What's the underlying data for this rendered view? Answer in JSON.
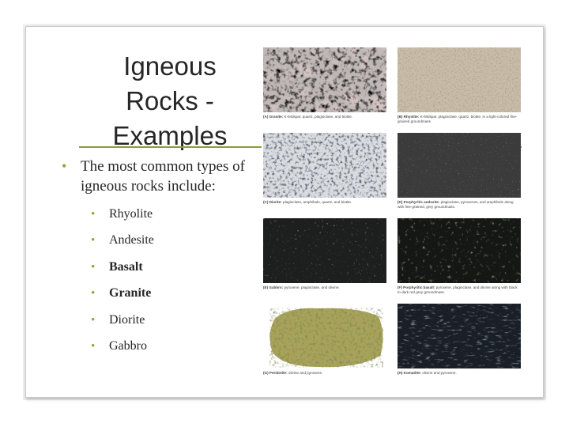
{
  "slide": {
    "title_lines": [
      "Igneous",
      "Rocks -",
      "Examples"
    ],
    "intro_bullet": "The most common types of igneous rocks include:",
    "rock_list": [
      {
        "label": "Rhyolite",
        "bold": false
      },
      {
        "label": "Andesite",
        "bold": false
      },
      {
        "label": "Basalt",
        "bold": true
      },
      {
        "label": "Granite",
        "bold": true
      },
      {
        "label": "Diorite",
        "bold": false
      },
      {
        "label": "Gabbro",
        "bold": false
      }
    ],
    "colors": {
      "accent_green": "#8ea43f",
      "rule_green": "#8a9c3a",
      "text": "#262626"
    }
  },
  "figure": {
    "panels": [
      {
        "tag": "(A) Granite:",
        "caption": "K-feldspar, quartz, plagioclase, and biotite."
      },
      {
        "tag": "(B) Rhyolite:",
        "caption": "K-feldspar, plagioclase, quartz, biotite, in a light-colored fine-grained groundmass."
      },
      {
        "tag": "(C) Diorite:",
        "caption": "plagioclase, amphibole, quartz, and biotite."
      },
      {
        "tag": "(D) Porphyritic andesite:",
        "caption": "plagioclase, pyroxenes, and amphibole along with fine-grained, grey groundmass."
      },
      {
        "tag": "(E) Gabbro:",
        "caption": "pyroxene, plagioclase, and olivine."
      },
      {
        "tag": "(F) Porphyritic basalt:",
        "caption": "pyroxene, plagioclase, and olivine along with black to dark red grey groundmass."
      },
      {
        "tag": "(G) Peridotite:",
        "caption": "olivine and pyroxene."
      },
      {
        "tag": "(H) Komatiite:",
        "caption": "olivine and pyroxene."
      }
    ]
  }
}
